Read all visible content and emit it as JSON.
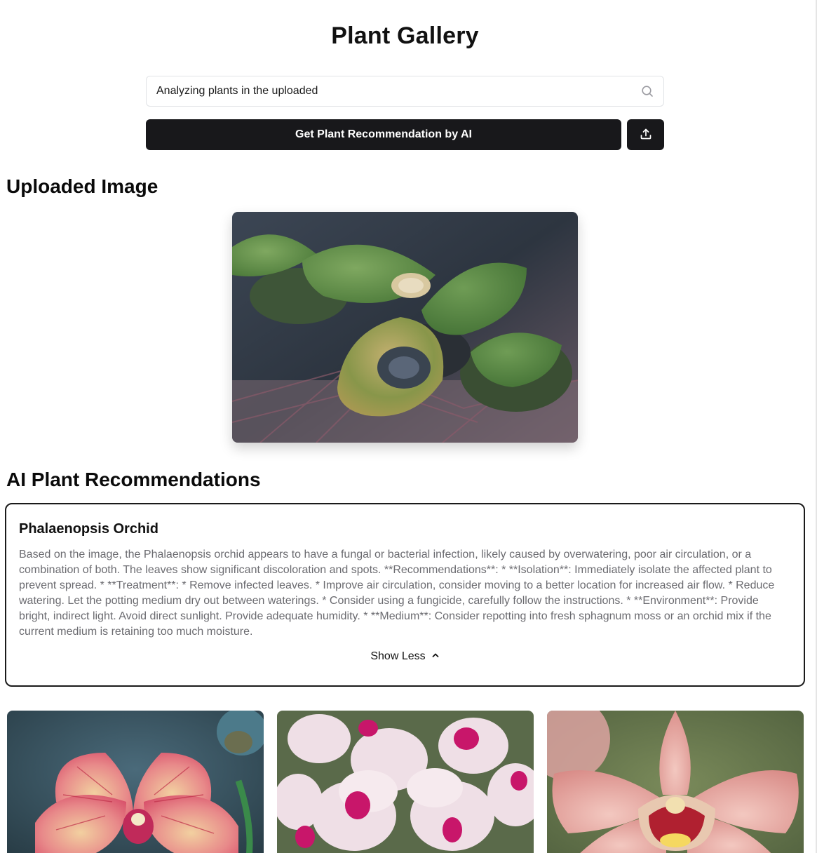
{
  "header": {
    "title": "Plant Gallery"
  },
  "search": {
    "value": "Analyzing plants in the uploaded",
    "icon": "search-icon"
  },
  "actions": {
    "ai_button_label": "Get Plant Recommendation by AI",
    "upload_icon": "upload-icon"
  },
  "uploaded": {
    "heading": "Uploaded Image"
  },
  "recommendations": {
    "heading": "AI Plant Recommendations",
    "card": {
      "title": "Phalaenopsis Orchid",
      "description": "Based on the image, the Phalaenopsis orchid appears to have a fungal or bacterial infection, likely caused by overwatering, poor air circulation, or a combination of both. The leaves show significant discoloration and spots. **Recommendations**: * **Isolation**: Immediately isolate the affected plant to prevent spread. * **Treatment**: * Remove infected leaves. * Improve air circulation, consider moving to a better location for increased air flow. * Reduce watering. Let the potting medium dry out between waterings. * Consider using a fungicide, carefully follow the instructions. * **Environment**: Provide bright, indirect light. Avoid direct sunlight. Provide adequate humidity. * **Medium**: Consider repotting into fresh sphagnum moss or an orchid mix if the current medium is retaining too much moisture.",
      "toggle_label": "Show Less"
    }
  },
  "colors": {
    "primary_button": "#18181b",
    "muted_text": "#6b6b70",
    "border": "#e1e3e6"
  }
}
